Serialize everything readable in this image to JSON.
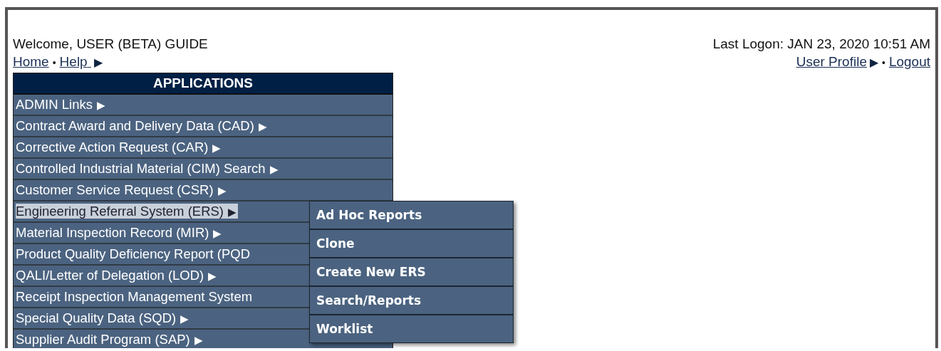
{
  "welcome": "Welcome, USER (BETA) GUIDE",
  "last_logon": "Last Logon: JAN 23, 2020 10:51 AM",
  "left_links": [
    {
      "label": "Home"
    },
    {
      "label": "Help",
      "arrow": "▶"
    }
  ],
  "right_links": [
    {
      "label": "User Profile",
      "arrow": "▶"
    },
    {
      "label": "Logout"
    }
  ],
  "separator": "•",
  "applications": {
    "title": "APPLICATIONS",
    "items": [
      {
        "label": "ADMIN Links",
        "arrow": "▶",
        "selected": false
      },
      {
        "label": "Contract Award and Delivery Data (CAD)",
        "arrow": "▶",
        "selected": false
      },
      {
        "label": "Corrective Action Request (CAR)",
        "arrow": "▶",
        "selected": false
      },
      {
        "label": "Controlled Industrial Material (CIM) Search",
        "arrow": "▶",
        "selected": false
      },
      {
        "label": "Customer Service Request (CSR)",
        "arrow": "▶",
        "selected": false
      },
      {
        "label": "Engineering Referral System (ERS)",
        "arrow": "▶",
        "selected": true,
        "submenu": [
          "Ad Hoc Reports",
          "Clone",
          "Create New ERS",
          "Search/Reports",
          "Worklist"
        ]
      },
      {
        "label": "Material Inspection Record (MIR)",
        "arrow": "▶",
        "selected": false
      },
      {
        "label": "Product Quality Deficiency Report (PQD",
        "selected": false
      },
      {
        "label": "QALI/Letter of Delegation (LOD)",
        "arrow": "▶",
        "selected": false
      },
      {
        "label": "Receipt Inspection Management System",
        "selected": false
      },
      {
        "label": "Special Quality Data (SQD)",
        "arrow": "▶",
        "selected": false
      },
      {
        "label": "Supplier Audit Program (SAP)",
        "arrow": "▶",
        "selected": false
      }
    ]
  }
}
